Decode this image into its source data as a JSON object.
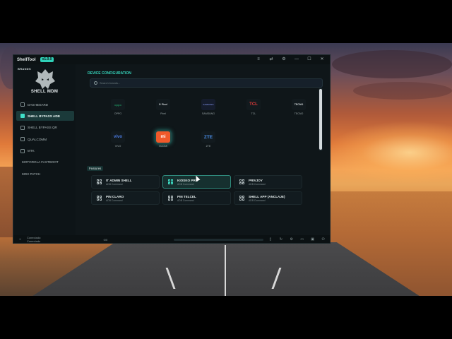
{
  "window": {
    "title": "ShellTool",
    "version": "v1.0.0",
    "titlebar_icons": [
      "menu-icon",
      "switch-icon",
      "settings-icon",
      "minimize-icon",
      "maximize-icon",
      "close-icon"
    ],
    "titlebar_glyphs": [
      "≡",
      "⇄",
      "⚙",
      "—",
      "☐",
      "✕"
    ]
  },
  "sidebar": {
    "brand_small": "BRANDS",
    "logo_text": "SHELL MDM",
    "items": [
      {
        "label": "DASHBOARD",
        "icon": "dashboard-icon",
        "active": false
      },
      {
        "label": "SHELL BYPASS ADB",
        "icon": "adb-icon",
        "active": true
      },
      {
        "label": "SHELL BYPASS QR",
        "icon": "qr-icon",
        "active": false
      },
      {
        "label": "QUALCOMM",
        "icon": "chip-icon",
        "active": false
      },
      {
        "label": "MTK",
        "icon": "chip-icon",
        "active": false
      },
      {
        "label": "MOTOROLA FASTBOOT",
        "icon": "",
        "active": false
      },
      {
        "label": "MDX PATCH",
        "icon": "",
        "active": false
      }
    ]
  },
  "main": {
    "section_title": "DEVICE CONFIGURATION",
    "search_placeholder": "Search brands...",
    "brands": [
      {
        "name": "OPPO",
        "logo": "oppo",
        "color": "#1e8a5a"
      },
      {
        "name": "Pixel",
        "logo": "G Pixel",
        "color": "#d0d6d8"
      },
      {
        "name": "SAMSUNG",
        "logo": "SAMSUNG",
        "color": "#3a4a8a"
      },
      {
        "name": "TCL",
        "logo": "TCL",
        "color": "#e23b3b"
      },
      {
        "name": "TECNO",
        "logo": "TECNO",
        "color": "#d0d6d8"
      },
      {
        "name": "VIVO",
        "logo": "vivo",
        "color": "#4a7ae0"
      },
      {
        "name": "XIAOMI",
        "logo": "mi",
        "color": "#ffffff",
        "selected": true
      },
      {
        "name": "ZTE",
        "logo": "ZTE",
        "color": "#4a8ee8"
      }
    ],
    "features_label": "Features",
    "features": [
      {
        "title": "IT ADMIN SHELL",
        "subtitle": "ADB Command",
        "active": false
      },
      {
        "title": "KIOSKO PRO",
        "subtitle": "ADB Command",
        "active": true
      },
      {
        "title": "PRIVJOY",
        "subtitle": "ADB Command",
        "active": false
      },
      {
        "title": "PIN CLARO",
        "subtitle": "ADB Command",
        "active": false
      },
      {
        "title": "PIN TELCEL",
        "subtitle": "ADB Command",
        "active": false
      },
      {
        "title": "SHELL APP (ANCLAJE)",
        "subtitle": "ADB Command",
        "active": false
      }
    ]
  },
  "statusbar": {
    "user": "Conectado: Conectado",
    "count": "0/0",
    "progress": 0,
    "icons": [
      "usb-icon",
      "refresh-icon",
      "settings-icon",
      "screen-icon",
      "monitor-icon",
      "power-icon"
    ],
    "glyphs": [
      "▯",
      "↻",
      "⚙",
      "▭",
      "▣",
      "⏻"
    ]
  },
  "colors": {
    "accent": "#3fe0c8",
    "window_bg": "#0f1619",
    "xiaomi_orange": "#f0592a"
  }
}
